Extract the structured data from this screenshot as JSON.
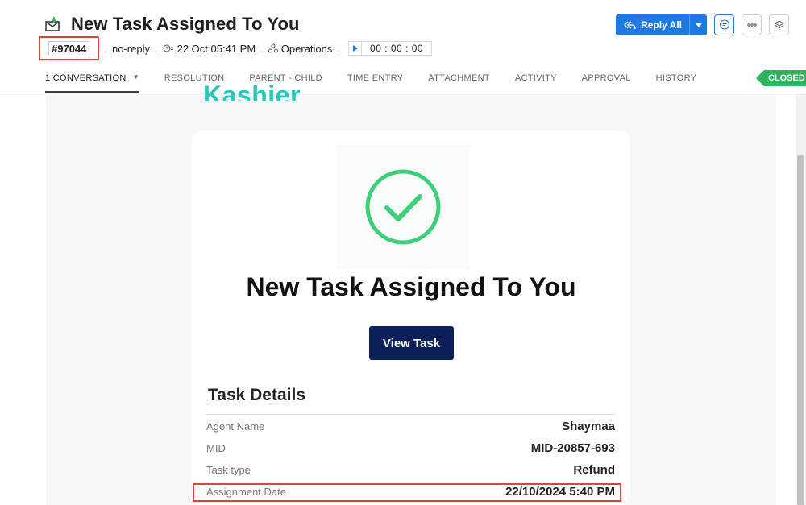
{
  "ticket": {
    "title": "New Task Assigned To You",
    "id": "#97044",
    "from": "no-reply",
    "datetime": "22 Oct 05:41 PM",
    "department": "Operations",
    "timer": "00 : 00 : 00"
  },
  "actions": {
    "reply_all_label": "Reply All"
  },
  "tabs": [
    {
      "label": "1 CONVERSATION"
    },
    {
      "label": "RESOLUTION"
    },
    {
      "label": "PARENT - CHILD"
    },
    {
      "label": "TIME ENTRY"
    },
    {
      "label": "ATTACHMENT"
    },
    {
      "label": "ACTIVITY"
    },
    {
      "label": "APPROVAL"
    },
    {
      "label": "HISTORY"
    }
  ],
  "status": "CLOSED",
  "email": {
    "brand": "Kashier",
    "heading": "New Task Assigned To You",
    "button_label": "View Task",
    "details_title": "Task Details",
    "details": [
      {
        "label": "Agent Name",
        "value": "Shaymaa"
      },
      {
        "label": "MID",
        "value": "MID-20857-693"
      },
      {
        "label": "Task type",
        "value": "Refund"
      },
      {
        "label": "Assignment Date",
        "value": "22/10/2024 5:40 PM"
      }
    ]
  },
  "colors": {
    "accent": "#1f7ae0",
    "closed": "#2db35d",
    "highlight": "#e0413d",
    "check": "#3ecf7a",
    "button": "#0c1f58"
  }
}
